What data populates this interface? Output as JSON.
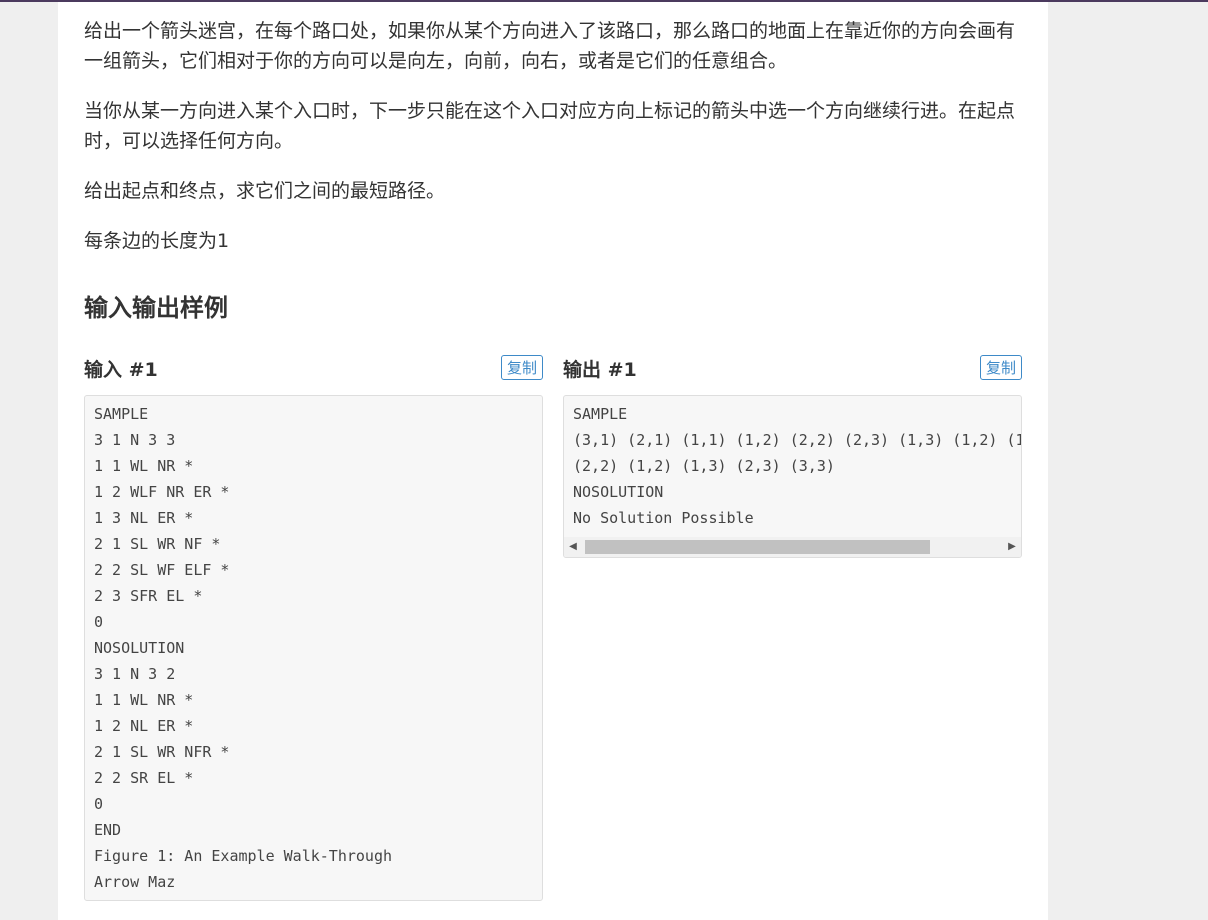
{
  "problem": {
    "paragraphs": [
      "给出一个箭头迷宫，在每个路口处，如果你从某个方向进入了该路口，那么路口的地面上在靠近你的方向会画有一组箭头，它们相对于你的方向可以是向左，向前，向右，或者是它们的任意组合。",
      "当你从某一方向进入某个入口时，下一步只能在这个入口对应方向上标记的箭头中选一个方向继续行进。在起点时，可以选择任何方向。",
      "给出起点和终点，求它们之间的最短路径。",
      "每条边的长度为1"
    ],
    "section_title": "输入输出样例"
  },
  "samples": {
    "input": {
      "label": "输入 #1",
      "copy_label": "复制",
      "lines": [
        "SAMPLE",
        "3 1 N 3 3",
        "1 1 WL NR *",
        "1 2 WLF NR ER *",
        "1 3 NL ER *",
        "2 1 SL WR NF *",
        "2 2 SL WF ELF *",
        "2 3 SFR EL *",
        "0",
        "NOSOLUTION",
        "3 1 N 3 2",
        "1 1 WL NR *",
        "1 2 NL ER *",
        "2 1 SL WR NFR *",
        "2 2 SR EL *",
        "0",
        "END",
        "Figure 1: An Example Walk-Through",
        "Arrow Maz"
      ]
    },
    "output": {
      "label": "输出 #1",
      "copy_label": "复制",
      "lines": [
        "SAMPLE",
        "(3,1) (2,1) (1,1) (1,2) (2,2) (2,3) (1,3) (1,2) (1",
        "(2,2) (1,2) (1,3) (2,3) (3,3)",
        "NOSOLUTION",
        "No Solution Possible"
      ],
      "scrollbar": {
        "left_arrow": "◀",
        "right_arrow": "▶",
        "scroll_position_fraction": 0.0
      }
    }
  }
}
